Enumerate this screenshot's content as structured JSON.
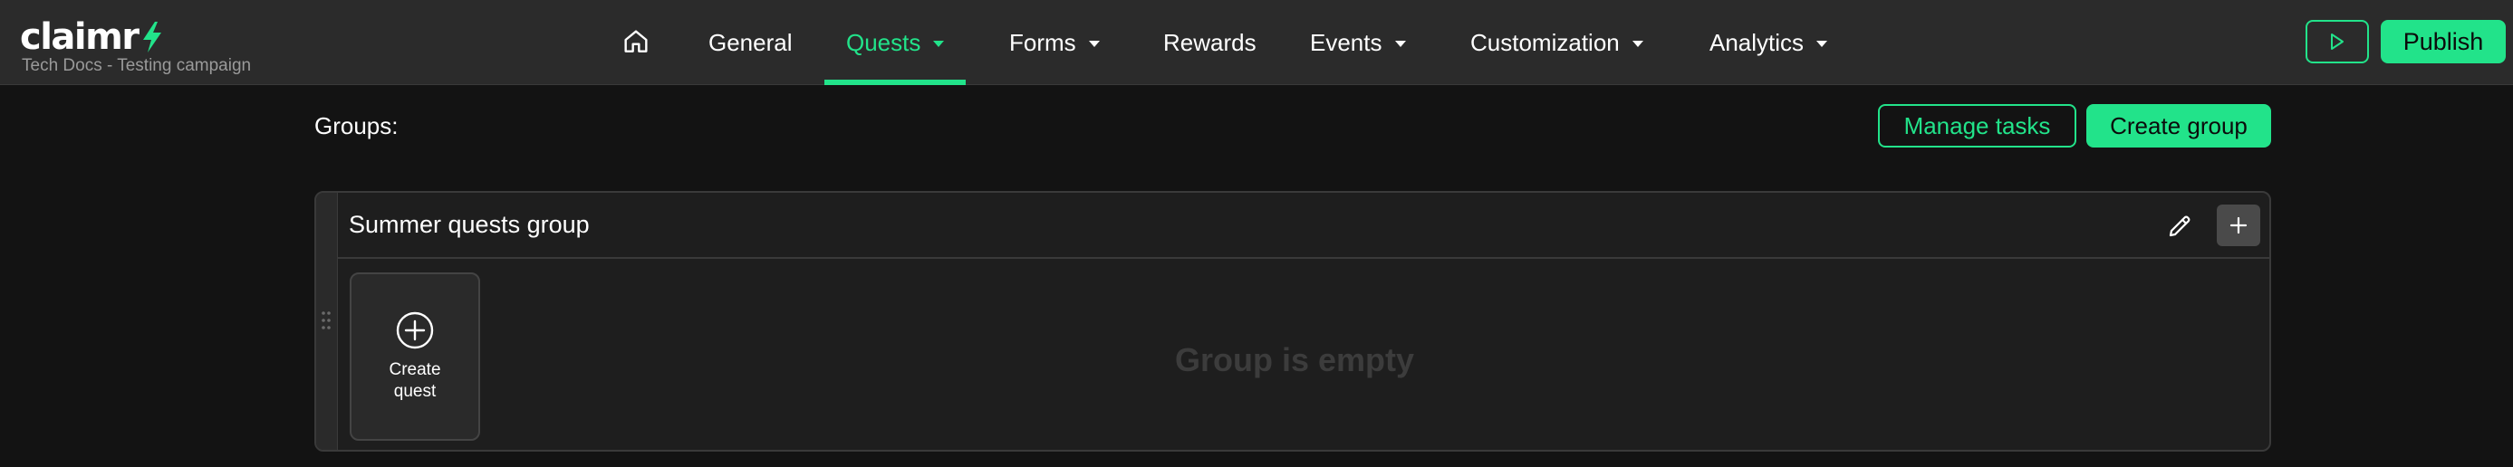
{
  "brand": {
    "name": "claimr",
    "campaign": "Tech Docs - Testing campaign",
    "accent_color": "#22e38a"
  },
  "nav": {
    "home_icon": "home-icon",
    "items": [
      {
        "label": "General",
        "has_dropdown": false,
        "active": false
      },
      {
        "label": "Quests",
        "has_dropdown": true,
        "active": true
      },
      {
        "label": "Forms",
        "has_dropdown": true,
        "active": false
      },
      {
        "label": "Rewards",
        "has_dropdown": false,
        "active": false
      },
      {
        "label": "Events",
        "has_dropdown": true,
        "active": false
      },
      {
        "label": "Customization",
        "has_dropdown": true,
        "active": false
      },
      {
        "label": "Analytics",
        "has_dropdown": true,
        "active": false
      }
    ]
  },
  "header_actions": {
    "preview_icon": "play-icon",
    "publish_label": "Publish"
  },
  "groups": {
    "label": "Groups:",
    "manage_tasks_label": "Manage tasks",
    "create_group_label": "Create group",
    "items": [
      {
        "title": "Summer quests group",
        "edit_icon": "pencil-icon",
        "add_icon": "plus-icon",
        "create_quest_label": "Create quest",
        "empty_text": "Group is empty"
      }
    ]
  }
}
